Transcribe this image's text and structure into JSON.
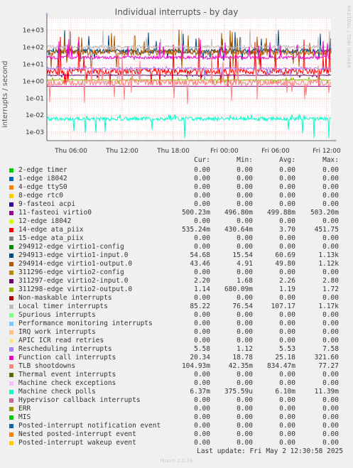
{
  "header": {
    "title": "Individual interrupts - by day",
    "side_label": "RRDTOOL / TOBI OETIKER"
  },
  "footer": {
    "last_update": "Last update: Fri May  2 12:30:58 2025",
    "munin": "Munin 2.0.76"
  },
  "legend_header": {
    "cur": "Cur:",
    "min": "Min:",
    "avg": "Avg:",
    "max": "Max:"
  },
  "chart_data": {
    "type": "line",
    "title": "Individual interrupts - by day",
    "ylabel": "interrupts / second",
    "yscale": "log",
    "ylim": [
      0.0005,
      5000
    ],
    "y_ticks": [
      "1e-03",
      "1e-02",
      "1e-01",
      "1e+00",
      "1e+01",
      "1e+02",
      "1e+03"
    ],
    "x_ticks": [
      "Thu 06:00",
      "Thu 12:00",
      "Thu 18:00",
      "Fri 00:00",
      "Fri 06:00",
      "Fri 12:00"
    ],
    "grid": true,
    "series": [
      {
        "name": "2-edge timer",
        "color": "#00cc00",
        "cur": "0.00",
        "min": "0.00",
        "avg": "0.00",
        "max": "0.00"
      },
      {
        "name": "1-edge i8042",
        "color": "#0066b3",
        "cur": "0.00",
        "min": "0.00",
        "avg": "0.00",
        "max": "0.00"
      },
      {
        "name": "4-edge ttyS0",
        "color": "#ff8000",
        "cur": "0.00",
        "min": "0.00",
        "avg": "0.00",
        "max": "0.00"
      },
      {
        "name": "8-edge rtc0",
        "color": "#ffcc00",
        "cur": "0.00",
        "min": "0.00",
        "avg": "0.00",
        "max": "0.00"
      },
      {
        "name": "9-fasteoi acpi",
        "color": "#330099",
        "cur": "0.00",
        "min": "0.00",
        "avg": "0.00",
        "max": "0.00"
      },
      {
        "name": "11-fasteoi virtio0",
        "color": "#990099",
        "cur": "500.23m",
        "min": "496.80m",
        "avg": "499.88m",
        "max": "503.20m"
      },
      {
        "name": "12-edge i8042",
        "color": "#ccff00",
        "cur": "0.00",
        "min": "0.00",
        "avg": "0.00",
        "max": "0.00"
      },
      {
        "name": "14-edge ata_piix",
        "color": "#ff0000",
        "cur": "535.24m",
        "min": "430.64m",
        "avg": "3.70",
        "max": "451.75"
      },
      {
        "name": "15-edge ata_piix",
        "color": "#808080",
        "cur": "0.00",
        "min": "0.00",
        "avg": "0.00",
        "max": "0.00"
      },
      {
        "name": "294912-edge virtio1-config",
        "color": "#008f00",
        "cur": "0.00",
        "min": "0.00",
        "avg": "0.00",
        "max": "0.00"
      },
      {
        "name": "294913-edge virtio1-input.0",
        "color": "#00487d",
        "cur": "54.68",
        "min": "15.54",
        "avg": "60.69",
        "max": "1.13k"
      },
      {
        "name": "294914-edge virtio1-output.0",
        "color": "#b35a00",
        "cur": "43.46",
        "min": "4.91",
        "avg": "49.80",
        "max": "1.12k"
      },
      {
        "name": "311296-edge virtio2-config",
        "color": "#b38f00",
        "cur": "0.00",
        "min": "0.00",
        "avg": "0.00",
        "max": "0.00"
      },
      {
        "name": "311297-edge virtio2-input.0",
        "color": "#6b006b",
        "cur": "2.20",
        "min": "1.68",
        "avg": "2.26",
        "max": "2.80"
      },
      {
        "name": "311298-edge virtio2-output.0",
        "color": "#8fb300",
        "cur": "1.14",
        "min": "680.09m",
        "avg": "1.19",
        "max": "1.72"
      },
      {
        "name": "Non-maskable interrupts",
        "color": "#b30000",
        "cur": "0.00",
        "min": "0.00",
        "avg": "0.00",
        "max": "0.00"
      },
      {
        "name": "Local timer interrupts",
        "color": "#bebebe",
        "cur": "85.22",
        "min": "76.54",
        "avg": "107.17",
        "max": "1.17k"
      },
      {
        "name": "Spurious interrupts",
        "color": "#80ff80",
        "cur": "0.00",
        "min": "0.00",
        "avg": "0.00",
        "max": "0.00"
      },
      {
        "name": "Performance monitoring interrupts",
        "color": "#80c9ff",
        "cur": "0.00",
        "min": "0.00",
        "avg": "0.00",
        "max": "0.00"
      },
      {
        "name": "IRQ work interrupts",
        "color": "#ffc080",
        "cur": "0.00",
        "min": "0.00",
        "avg": "0.00",
        "max": "0.00"
      },
      {
        "name": "APIC ICR read retries",
        "color": "#ffe680",
        "cur": "0.00",
        "min": "0.00",
        "avg": "0.00",
        "max": "0.00"
      },
      {
        "name": "Rescheduling interrupts",
        "color": "#aa80ff",
        "cur": "5.58",
        "min": "1.12",
        "avg": "5.53",
        "max": "7.58"
      },
      {
        "name": "Function call interrupts",
        "color": "#ee00cc",
        "cur": "20.34",
        "min": "18.78",
        "avg": "25.18",
        "max": "321.60"
      },
      {
        "name": "TLB shootdowns",
        "color": "#ff8080",
        "cur": "104.93m",
        "min": "42.35m",
        "avg": "834.47m",
        "max": "77.27"
      },
      {
        "name": "Thermal event interrupts",
        "color": "#666600",
        "cur": "0.00",
        "min": "0.00",
        "avg": "0.00",
        "max": "0.00"
      },
      {
        "name": "Machine check exceptions",
        "color": "#ffbfff",
        "cur": "0.00",
        "min": "0.00",
        "avg": "0.00",
        "max": "0.00"
      },
      {
        "name": "Machine check polls",
        "color": "#00ffcc",
        "cur": "6.37m",
        "min": "375.59u",
        "avg": "6.10m",
        "max": "11.39m"
      },
      {
        "name": "Hypervisor callback interrupts",
        "color": "#cc6699",
        "cur": "0.00",
        "min": "0.00",
        "avg": "0.00",
        "max": "0.00"
      },
      {
        "name": "ERR",
        "color": "#999900",
        "cur": "0.00",
        "min": "0.00",
        "avg": "0.00",
        "max": "0.00"
      },
      {
        "name": "MIS",
        "color": "#00cc00",
        "cur": "0.00",
        "min": "0.00",
        "avg": "0.00",
        "max": "0.00"
      },
      {
        "name": "Posted-interrupt notification event",
        "color": "#0066b3",
        "cur": "0.00",
        "min": "0.00",
        "avg": "0.00",
        "max": "0.00"
      },
      {
        "name": "Nested posted-interrupt event",
        "color": "#ff8000",
        "cur": "0.00",
        "min": "0.00",
        "avg": "0.00",
        "max": "0.00"
      },
      {
        "name": "Posted-interrupt wakeup event",
        "color": "#ffcc00",
        "cur": "0.00",
        "min": "0.00",
        "avg": "0.00",
        "max": "0.00"
      }
    ]
  }
}
